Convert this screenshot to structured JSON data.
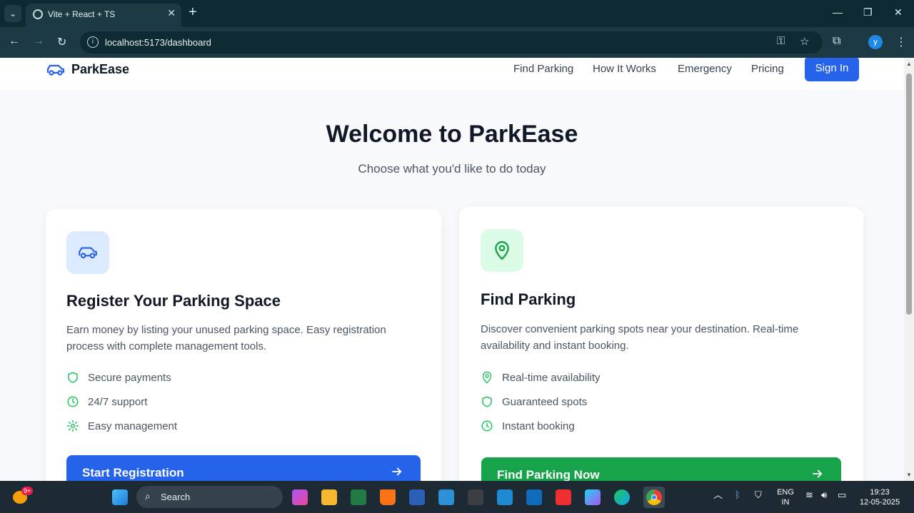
{
  "browser": {
    "tab_title": "Vite + React + TS",
    "url": "localhost:5173/dashboard",
    "profile_initial": "y"
  },
  "header": {
    "logo_text": "ParkEase",
    "nav": [
      "Find Parking",
      "How It Works",
      "Emergency",
      "Pricing"
    ],
    "signin_label": "Sign In"
  },
  "hero": {
    "title": "Welcome to ParkEase",
    "subtitle": "Choose what you'd like to do today"
  },
  "cards": [
    {
      "title": "Register Your Parking Space",
      "desc_line1": "Earn money by listing your unused parking space. Easy registration",
      "desc_line2": "process with complete management tools.",
      "features": [
        "Secure payments",
        "24/7 support",
        "Easy management"
      ],
      "cta": "Start Registration",
      "icon": "car-icon"
    },
    {
      "title": "Find Parking",
      "desc_line1": "Discover convenient parking spots near your destination. Real-time",
      "desc_line2": "availability and instant booking.",
      "features": [
        "Real-time availability",
        "Guaranteed spots",
        "Instant booking"
      ],
      "cta": "Find Parking Now",
      "icon": "map-pin-icon"
    }
  ],
  "colors": {
    "primary_blue": "#2563eb",
    "primary_green": "#16a34a",
    "feature_green": "#22c55e",
    "icon_bg_blue": "#dbeafe",
    "icon_bg_green": "#dcfce7"
  },
  "taskbar": {
    "search_label": "Search",
    "badge": "9+",
    "lang_line1": "ENG",
    "lang_line2": "IN",
    "time": "19:23",
    "date": "12-05-2025"
  }
}
